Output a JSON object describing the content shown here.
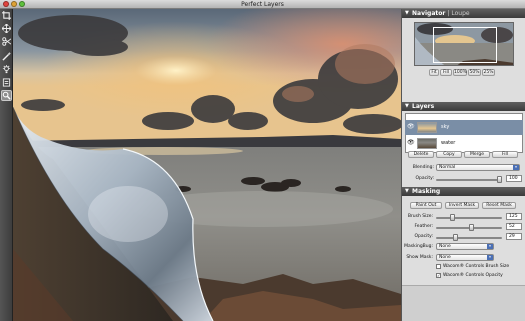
{
  "window": {
    "title": "Perfect Layers"
  },
  "tools": [
    {
      "name": "crop-tool-icon"
    },
    {
      "name": "move-tool-icon"
    },
    {
      "name": "transform-tool-icon"
    },
    {
      "name": "brush-tool-icon"
    },
    {
      "name": "light-tool-icon"
    },
    {
      "name": "stamp-tool-icon"
    },
    {
      "name": "zoom-tool-icon"
    }
  ],
  "navigator": {
    "tab1": "Navigator",
    "tab2": "Loupe",
    "zoom_buttons": [
      "Fit",
      "Fill",
      "100%",
      "50%",
      "25%"
    ]
  },
  "layers": {
    "title": "Layers",
    "items": [
      {
        "name": "sky",
        "selected": true
      },
      {
        "name": "water",
        "selected": false
      }
    ],
    "buttons": [
      "Delete",
      "Copy",
      "Merge",
      "Fill"
    ],
    "blending_label": "Blending:",
    "blending_value": "Normal",
    "opacity_label": "Opacity:",
    "opacity_value": "100"
  },
  "masking": {
    "title": "Masking",
    "buttons": [
      "Paint Out",
      "Invert Mask",
      "Reset Mask"
    ],
    "brush_size_label": "Brush Size:",
    "brush_size_value": "125",
    "feather_label": "Feather:",
    "feather_value": "52",
    "opacity_label": "Opacity:",
    "opacity_value": "29",
    "masking_bug_label": "MaskingBug:",
    "masking_bug_value": "None",
    "show_mask_label": "Show Mask:",
    "show_mask_value": "None",
    "wacom_brush": "Wacom® Controls Brush Size",
    "wacom_opacity": "Wacom® Controls Opacity"
  },
  "colors": {
    "accent": "#4a6fb5",
    "panel_bg": "#dedede",
    "header_bg": "#3b3b3b"
  }
}
